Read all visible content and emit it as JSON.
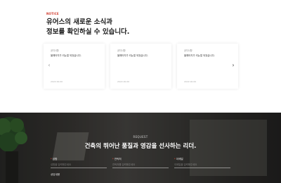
{
  "notice": {
    "tag": "NOTICE",
    "title_line1": "유어스의 새로운 소식과",
    "title_line2": "정보를 확인하실 수 있습니다.",
    "cards": [
      {
        "category": "공지사항",
        "text": "올해어지가 리뉴얼 되었습니다.",
        "date": "2022.00.00"
      },
      {
        "category": "공지사항",
        "text": "올해어지가 리뉴얼 되었습니다.",
        "date": "2022.00.00"
      },
      {
        "category": "공지사항",
        "text": "올해어지가 리뉴얼 되었습니다.",
        "date": "2022.00.00"
      }
    ],
    "prev_glyph": "‹",
    "next_glyph": "›"
  },
  "request": {
    "tag": "REQUEST",
    "title": "건축의 뛰어난 품질과 영감을 선사하는 리더.",
    "fields": [
      {
        "label": "성함",
        "placeholder": "성함을 입력해주세요"
      },
      {
        "label": "연락처",
        "placeholder": "연락처를 입력해주세요"
      },
      {
        "label": "이메일",
        "placeholder": "이메일을 입력해주세요"
      }
    ],
    "bottom_label": "상담내용"
  },
  "colors": {
    "accent": "#d0392b",
    "dark_bg": "#2f2e2c"
  }
}
